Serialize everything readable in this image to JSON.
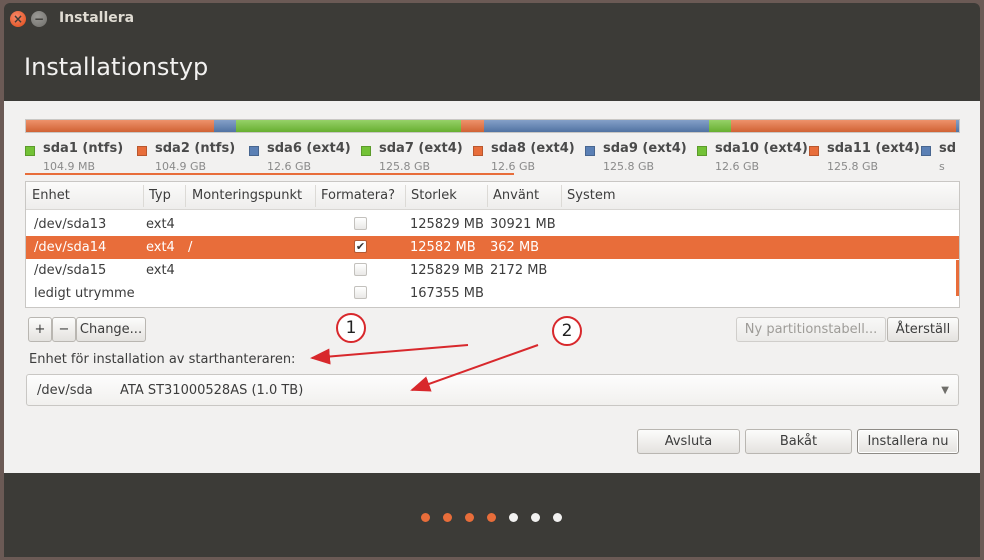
{
  "window": {
    "title": "Installera",
    "header": "Installationstyp"
  },
  "partition_bar": [
    {
      "color": "#e86d3a",
      "weight": 10.49
    },
    {
      "color": "#5b80b5",
      "weight": 1.26
    },
    {
      "color": "#73c236",
      "weight": 12.58
    },
    {
      "color": "#e86d3a",
      "weight": 1.26
    },
    {
      "color": "#5b80b5",
      "weight": 12.58
    },
    {
      "color": "#73c236",
      "weight": 1.26
    },
    {
      "color": "#e86d3a",
      "weight": 12.58
    },
    {
      "color": "#5b80b5",
      "weight": 0.15
    }
  ],
  "legend": [
    {
      "name": "sda1 (ntfs)",
      "size": "104.9 MB",
      "color": "#73c236"
    },
    {
      "name": "sda2 (ntfs)",
      "size": "104.9 GB",
      "color": "#e86d3a"
    },
    {
      "name": "sda6 (ext4)",
      "size": "12.6 GB",
      "color": "#5b80b5"
    },
    {
      "name": "sda7 (ext4)",
      "size": "125.8 GB",
      "color": "#73c236"
    },
    {
      "name": "sda8 (ext4)",
      "size": "12.6 GB",
      "color": "#e86d3a"
    },
    {
      "name": "sda9 (ext4)",
      "size": "125.8 GB",
      "color": "#5b80b5"
    },
    {
      "name": "sda10 (ext4)",
      "size": "12.6 GB",
      "color": "#73c236"
    },
    {
      "name": "sda11 (ext4)",
      "size": "125.8 GB",
      "color": "#e86d3a"
    },
    {
      "name": "sd",
      "size": "s",
      "color": "#5b80b5"
    }
  ],
  "table": {
    "headers": [
      "Enhet",
      "Typ",
      "Monteringspunkt",
      "Formatera?",
      "Storlek",
      "Använt",
      "System"
    ],
    "rows": [
      {
        "device": "/dev/sda13",
        "type": "ext4",
        "mount": "",
        "format": false,
        "size": "125829 MB",
        "used": "30921 MB",
        "selected": false,
        "checkbox": true
      },
      {
        "device": "/dev/sda14",
        "type": "ext4",
        "mount": "/",
        "format": true,
        "size": "12582 MB",
        "used": "362 MB",
        "selected": true,
        "checkbox": true
      },
      {
        "device": "/dev/sda15",
        "type": "ext4",
        "mount": "",
        "format": false,
        "size": "125829 MB",
        "used": "2172 MB",
        "selected": false,
        "checkbox": true
      },
      {
        "device": "ledigt utrymme",
        "type": "",
        "mount": "",
        "format": false,
        "size": "167355 MB",
        "used": "",
        "selected": false,
        "checkbox": true
      }
    ]
  },
  "toolbar": {
    "add_label": "+",
    "remove_label": "−",
    "change_label": "Change...",
    "new_table_label": "Ny partitionstabell...",
    "revert_label": "Återställ"
  },
  "boot": {
    "label": "Enhet för installation av starthanteraren:",
    "device": "/dev/sda",
    "description": "ATA ST31000528AS (1.0 TB)",
    "arrow": "▼"
  },
  "callouts": {
    "one": "1",
    "two": "2"
  },
  "buttons": {
    "quit": "Avsluta",
    "back": "Bakåt",
    "install": "Installera nu"
  },
  "progress": {
    "total": 7,
    "active": 4,
    "active_color": "#e86d3a",
    "inactive_color": "#f2f1f0"
  },
  "icons": {
    "close": "×",
    "minimize": "−",
    "check": "✔"
  }
}
